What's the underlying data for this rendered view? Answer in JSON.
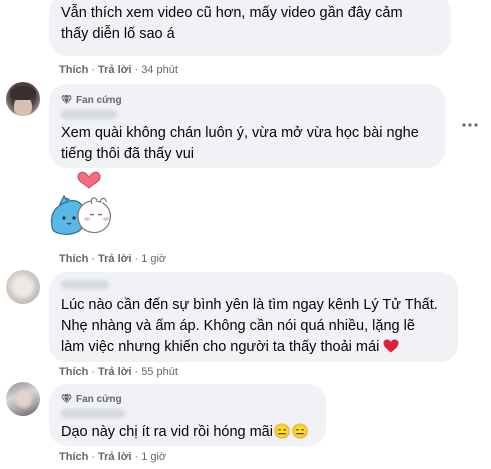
{
  "comments": [
    {
      "badge": "",
      "text": "Vẫn thích xem video cũ hơn, mấy video gần đây cảm\nthấy diễn lố sao á",
      "like": "Thích",
      "reply": "Trả lời",
      "time": "34 phút"
    },
    {
      "badge": "Fan cứng",
      "text": "Xem quài không chán luôn ý, vừa mở vừa học bài nghe\ntiếng thôi đã thấy vui",
      "like": "Thích",
      "reply": "Trả lời",
      "time": "1 giờ"
    },
    {
      "badge": "",
      "text": "Lúc nào cần đến sự bình yên là tìm ngay kênh Lý Tử Thất.\nNhẹ nhàng và ấm áp. Không cần nói quá nhiều, lặng lẽ\nlàm việc nhưng khiến cho người ta thấy thoải mái",
      "like": "Thích",
      "reply": "Trả lời",
      "time": "55 phút"
    },
    {
      "badge": "Fan cứng",
      "text": "Dạo này chị ít ra vid rồi hóng mãi😑😑",
      "like": "Thích",
      "reply": "Trả lời",
      "time": "1 giờ"
    }
  ],
  "colors": {
    "bubble": "#f0f2f5",
    "meta": "#65676b",
    "heart": "#e41e3f",
    "sticker_blue": "#58b7e6"
  },
  "icons": [
    "diamond-icon",
    "more-options-icon",
    "heart-emoji-icon",
    "sticker"
  ]
}
